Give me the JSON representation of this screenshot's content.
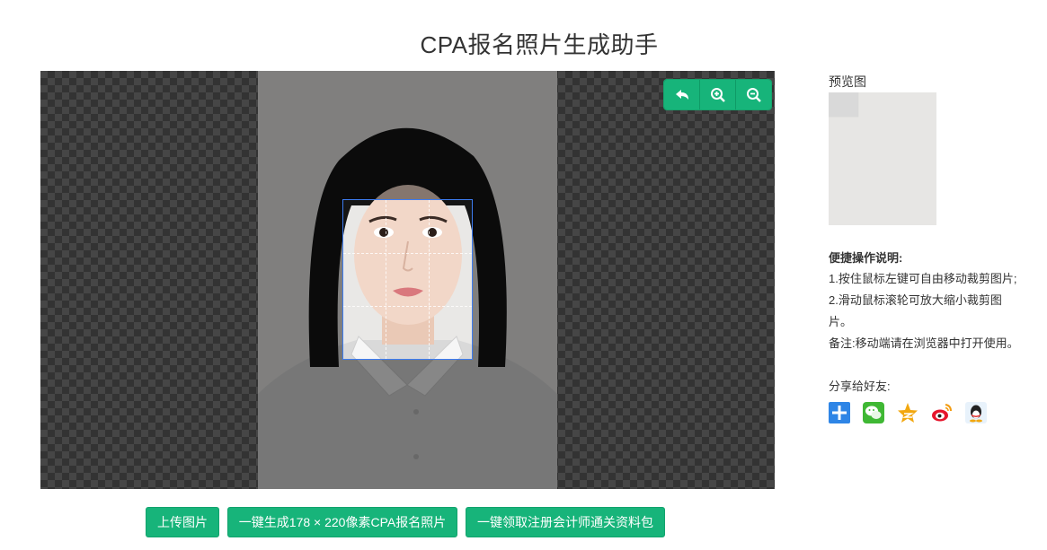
{
  "page": {
    "title": "CPA报名照片生成助手"
  },
  "cropper": {
    "toolbar": [
      "undo-icon",
      "zoom-in-icon",
      "zoom-out-icon"
    ]
  },
  "buttons": {
    "upload": "上传图片",
    "generate": "一键生成178 × 220像素CPA报名照片",
    "materials": "一键领取注册会计师通关资料包"
  },
  "sidebar": {
    "preview_label": "预览图",
    "help_title": "便捷操作说明:",
    "help_lines": [
      "1.按住鼠标左键可自由移动裁剪图片;",
      "2.滑动鼠标滚轮可放大缩小裁剪图片。",
      "备注:移动端请在浏览器中打开使用。"
    ],
    "share_label": "分享给好友:",
    "share_icons": [
      "plus-share-icon",
      "wechat-icon",
      "qzone-icon",
      "weibo-icon",
      "qq-icon"
    ]
  },
  "colors": {
    "accent": "#17b47a",
    "crop_border": "#3d7cf0"
  }
}
